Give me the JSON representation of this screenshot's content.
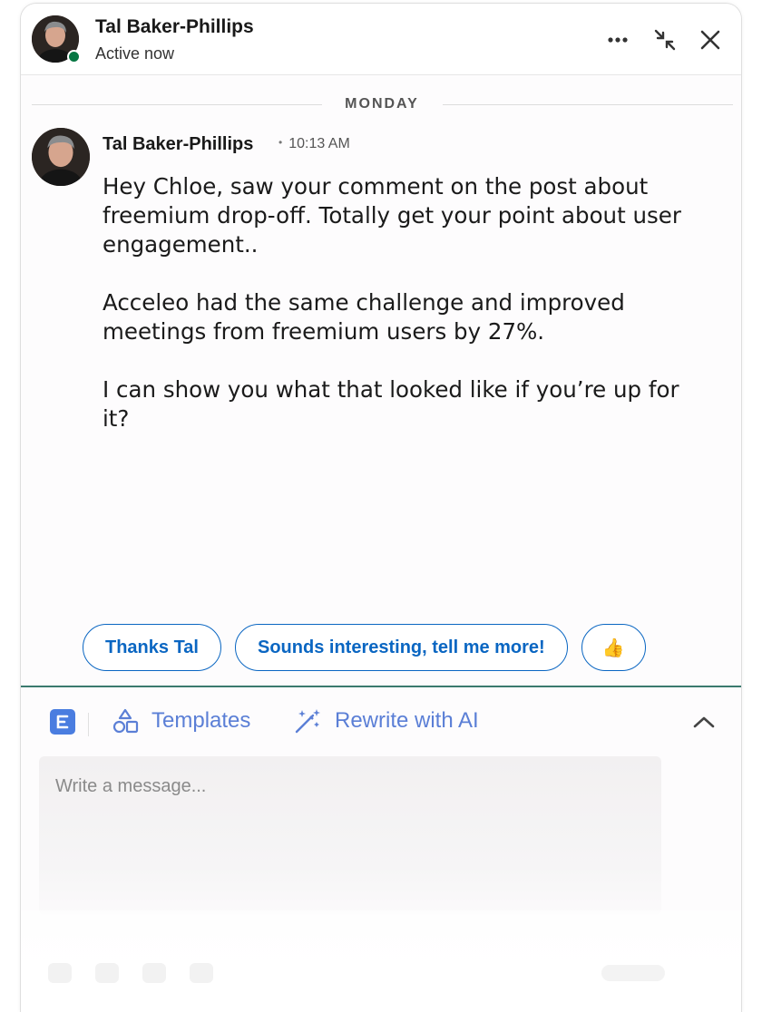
{
  "header": {
    "name": "Tal Baker-Phillips",
    "status": "Active now",
    "more_icon": "more-horizontal-icon",
    "minimize_icon": "collapse-arrows-icon",
    "close_icon": "close-icon"
  },
  "conversation": {
    "day": "MONDAY",
    "message": {
      "sender": "Tal Baker-Phillips",
      "time": "10:13 AM",
      "paragraphs": [
        "Hey Chloe, saw your comment on the post about freemium drop-off. Totally get your point about user engagement..",
        "Acceleo had the same challenge and improved meetings from freemium users by 27%.",
        "I can show you what that looked like if you’re up for it?"
      ]
    }
  },
  "quick_replies": [
    "Thanks Tal",
    "Sounds interesting, tell me more!",
    "👍"
  ],
  "compose": {
    "templates_label": "Templates",
    "rewrite_label": "Rewrite with AI",
    "placeholder": "Write a message..."
  },
  "colors": {
    "accent": "#0a66c2",
    "toolbar_text": "#5b7fd6",
    "presence": "#057642",
    "compose_border": "#3b7a6e"
  }
}
